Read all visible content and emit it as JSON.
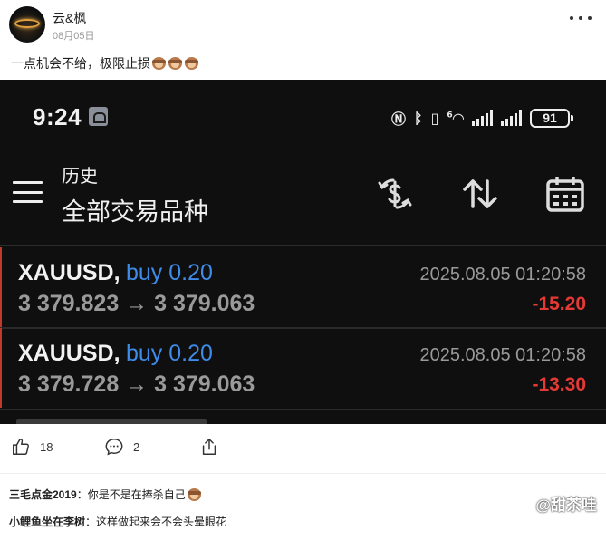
{
  "post": {
    "username": "云&枫",
    "date": "08月05日",
    "text": "一点机会不给，极限止损"
  },
  "phone": {
    "status": {
      "time": "9:24",
      "network_label": "6",
      "battery": "91"
    },
    "app": {
      "title": "历史",
      "subtitle": "全部交易品种"
    },
    "trades": [
      {
        "symbol": "XAUUSD,",
        "side": "buy 0.20",
        "prices": "3 379.823 → 3 379.063",
        "date": "2025.08.05 01:20:58",
        "profit": "-15.20"
      },
      {
        "symbol": "XAUUSD,",
        "side": "buy 0.20",
        "prices": "3 379.728 → 3 379.063",
        "date": "2025.08.05 01:20:58",
        "profit": "-13.30"
      }
    ]
  },
  "actions": {
    "likes": "18",
    "comments": "2"
  },
  "comments": [
    {
      "author": "三毛点金2019",
      "sep": "：",
      "text": "你是不是在捧杀自己"
    },
    {
      "author": "小鲤鱼坐在李树",
      "sep": "：",
      "text": "这样做起来会不会头晕眼花"
    }
  ],
  "watermark": "@甜茶哇",
  "icons": [
    "more-icon",
    "monkey-emoji-icon",
    "menu-icon",
    "currency-exchange-icon",
    "sort-icon",
    "calendar-icon",
    "thumbs-up-icon",
    "comment-icon",
    "share-icon"
  ],
  "colors": {
    "buy": "#3f8be8",
    "loss": "#e53935",
    "phone_bg": "#0f0f0f"
  }
}
